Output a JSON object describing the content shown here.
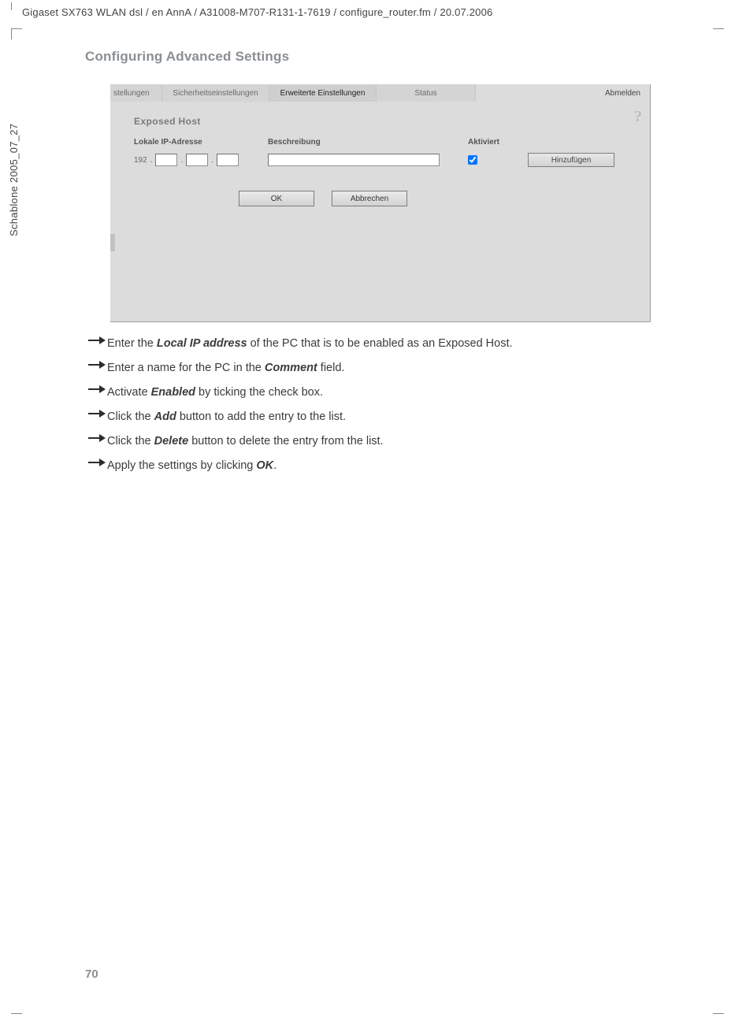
{
  "doc": {
    "header_path": "Gigaset SX763 WLAN dsl / en AnnA / A31008-M707-R131-1-7619 / configure_router.fm / 20.07.2006",
    "side_text": "Schablone 2005_07_27",
    "section_title": "Configuring Advanced Settings",
    "page_number": "70"
  },
  "panel": {
    "tabs": {
      "t1": "stellungen",
      "t2": "Sicherheitseinstellungen",
      "t3": "Erweiterte Einstellungen",
      "t4": "Status"
    },
    "logout": "Abmelden",
    "title": "Exposed Host",
    "labels": {
      "ip": "Lokale IP-Adresse",
      "desc": "Beschreibung",
      "active": "Aktiviert"
    },
    "ip_first": "192",
    "buttons": {
      "add": "Hinzufügen",
      "ok": "OK",
      "cancel": "Abbrechen"
    }
  },
  "instructions": [
    {
      "pre": "Enter the ",
      "b": "Local IP address",
      "post": " of the PC that is to be enabled as an Exposed Host."
    },
    {
      "pre": "Enter a name for the PC in the ",
      "b": "Comment",
      "post": " field."
    },
    {
      "pre": "Activate ",
      "b": "Enabled",
      "post": " by ticking the check box."
    },
    {
      "pre": "Click the ",
      "b": "Add",
      "post": " button to add the entry to the list."
    },
    {
      "pre": "Click the ",
      "b": "Delete",
      "post": " button to delete the entry from the list."
    },
    {
      "pre": "Apply the settings by clicking ",
      "b": "OK",
      "post": "."
    }
  ]
}
